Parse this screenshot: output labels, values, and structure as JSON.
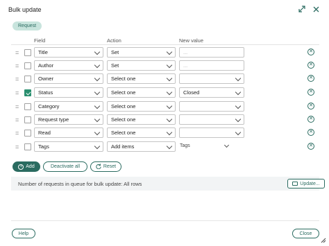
{
  "dialog": {
    "title": "Bulk update",
    "tab_label": "Request"
  },
  "columns": {
    "field": "Field",
    "action": "Action",
    "new_value": "New value"
  },
  "rows": [
    {
      "checked": false,
      "field": "Title",
      "action": "Set",
      "value": "...",
      "value_kind": "text"
    },
    {
      "checked": false,
      "field": "Author",
      "action": "Set",
      "value": "...",
      "value_kind": "text"
    },
    {
      "checked": false,
      "field": "Owner",
      "action": "Select one",
      "value": "",
      "value_kind": "select"
    },
    {
      "checked": true,
      "field": "Status",
      "action": "Select one",
      "value": "Closed",
      "value_kind": "select"
    },
    {
      "checked": false,
      "field": "Category",
      "action": "Select one",
      "value": "",
      "value_kind": "select"
    },
    {
      "checked": false,
      "field": "Request type",
      "action": "Select one",
      "value": "",
      "value_kind": "select"
    },
    {
      "checked": false,
      "field": "Read",
      "action": "Select one",
      "value": "",
      "value_kind": "select"
    },
    {
      "checked": false,
      "field": "Tags",
      "action": "Add items",
      "value": "Tags",
      "value_kind": "plain"
    }
  ],
  "buttons": {
    "add": "Add",
    "deactivate_all": "Deactivate all",
    "reset": "Reset",
    "update": "Update...",
    "help": "Help",
    "close": "Close"
  },
  "queue": {
    "text": "Number of requests in queue for bulk update:  All rows"
  },
  "colors": {
    "accent": "#2a6b60",
    "checkbox": "#2a8f6f",
    "pill_bg": "#c8e4dd"
  },
  "icons": [
    "expand-icon",
    "close-icon",
    "chevron-down-icon",
    "remove-row-icon",
    "plus-icon",
    "reset-icon",
    "update-icon",
    "resize-grip-icon"
  ]
}
